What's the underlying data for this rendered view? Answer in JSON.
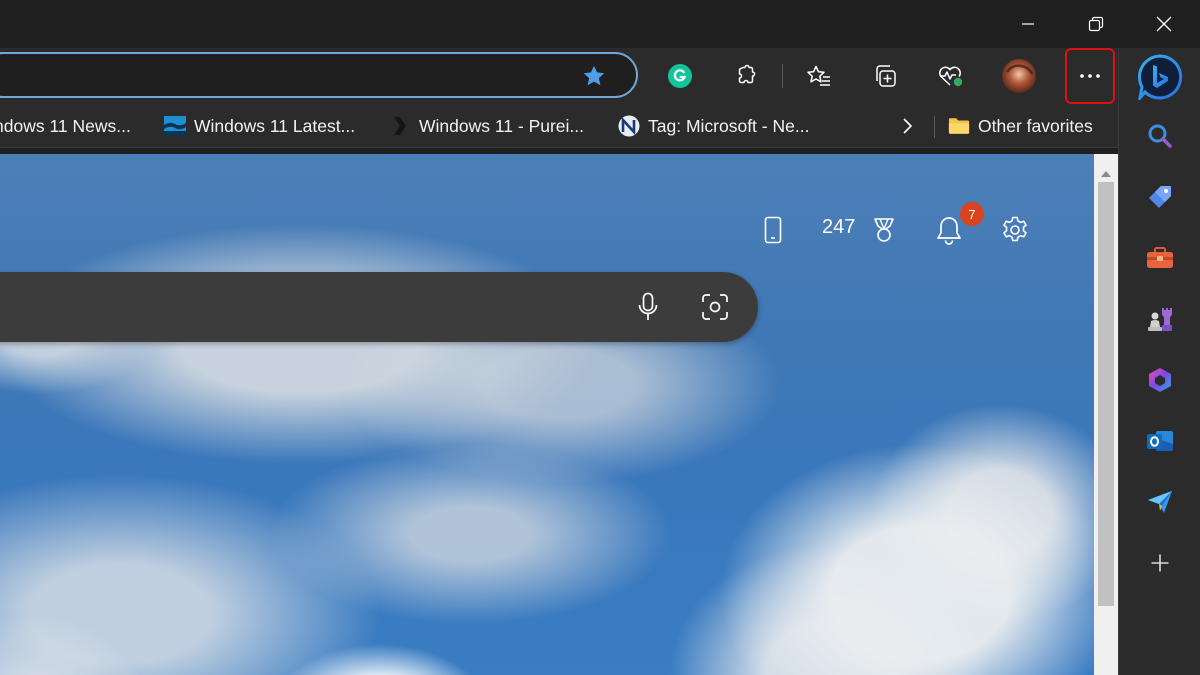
{
  "window_controls": {
    "minimize": "minimize",
    "restore": "restore",
    "close": "close"
  },
  "address_bar": {
    "value": "",
    "placeholder": ""
  },
  "toolbar": {
    "icons": [
      "grammarly-icon",
      "extensions-icon",
      "favorites-icon",
      "collections-icon",
      "browser-essentials-icon",
      "profile-avatar",
      "more-icon"
    ]
  },
  "bookmarks": {
    "items": [
      {
        "label": "ndows 11 News...",
        "icon": "bookmark-icon"
      },
      {
        "label": "Windows 11 Latest...",
        "icon": "bookmark-icon"
      },
      {
        "label": "Windows 11 - Purei...",
        "icon": "bookmark-icon"
      },
      {
        "label": "Tag: Microsoft - Ne...",
        "icon": "bookmark-icon"
      }
    ],
    "other_favorites": "Other favorites"
  },
  "newtab": {
    "points": "247",
    "notifications_count": "7",
    "search_value": "",
    "search_placeholder": ""
  },
  "sidebar": {
    "icons": [
      "copilot-icon",
      "search-icon",
      "shopping-tag-icon",
      "tools-icon",
      "games-icon",
      "microsoft-365-icon",
      "outlook-icon",
      "drop-icon",
      "add-icon"
    ]
  },
  "colors": {
    "address_border": "#6ea8d8",
    "more_highlight": "#e01010",
    "badge": "#d9441e",
    "star": "#4f9ee6"
  }
}
